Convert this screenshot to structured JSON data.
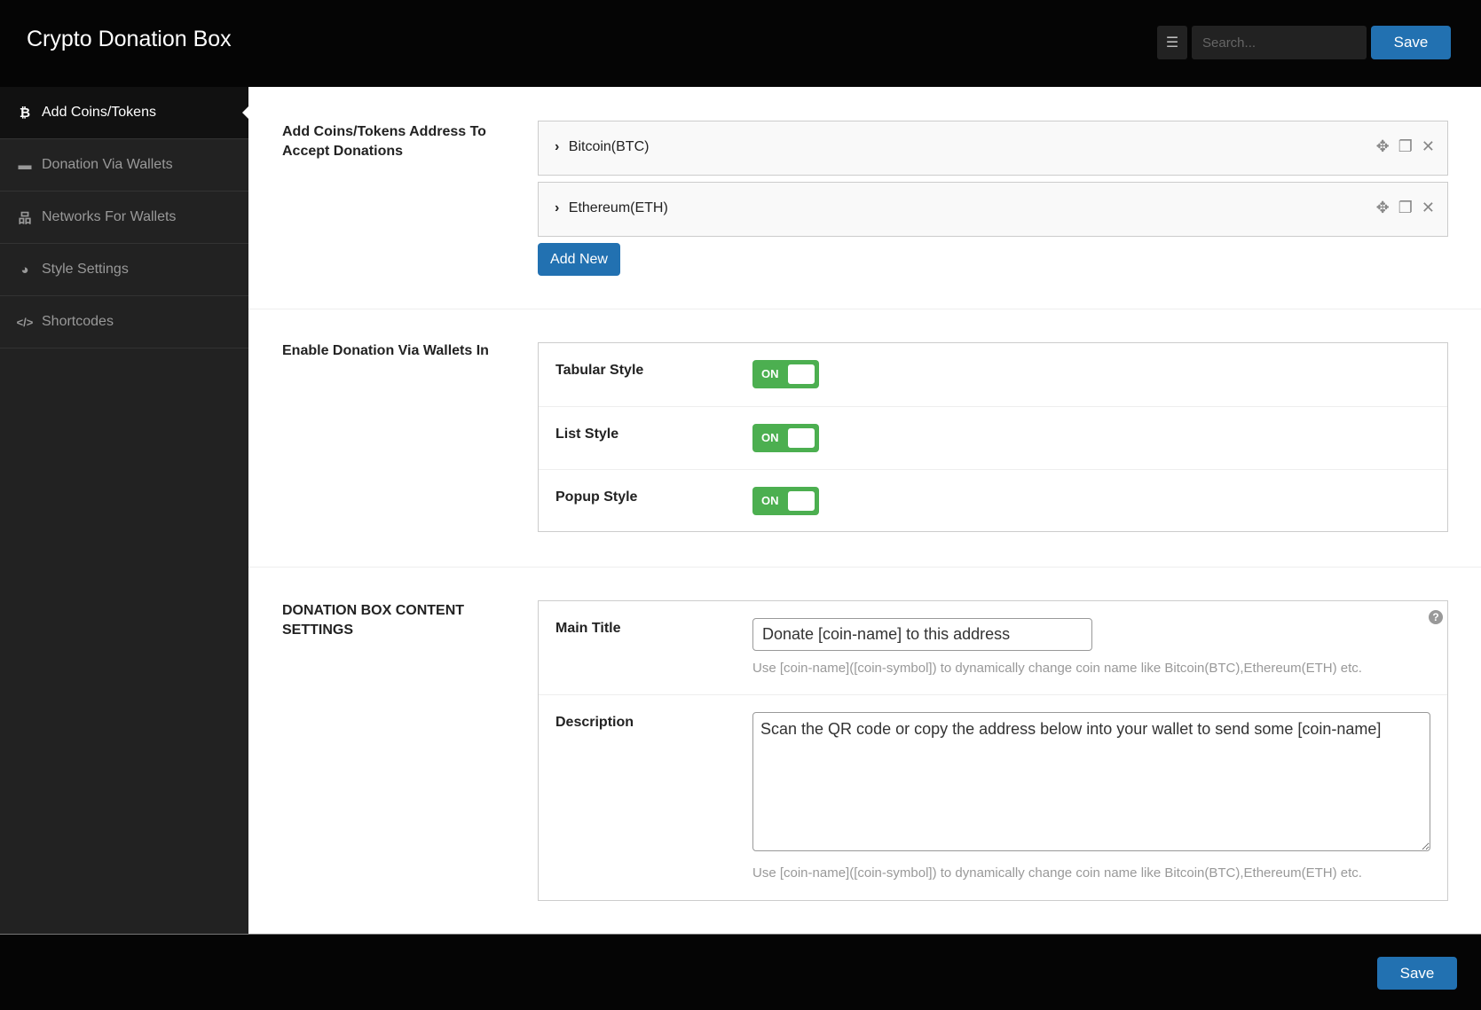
{
  "header": {
    "title": "Crypto Donation Box",
    "search_placeholder": "Search...",
    "save_label": "Save"
  },
  "sidebar": {
    "items": [
      {
        "label": "Add Coins/Tokens",
        "icon": "bitcoin-icon",
        "glyph": "₿",
        "active": true
      },
      {
        "label": "Donation Via Wallets",
        "icon": "wallet-icon",
        "glyph": "▬",
        "active": false
      },
      {
        "label": "Networks For Wallets",
        "icon": "network-icon",
        "glyph": "品",
        "active": false
      },
      {
        "label": "Style Settings",
        "icon": "palette-icon",
        "glyph": "◕",
        "active": false
      },
      {
        "label": "Shortcodes",
        "icon": "code-icon",
        "glyph": "</>",
        "active": false
      }
    ]
  },
  "sections": {
    "coins": {
      "label": "Add Coins/Tokens Address To Accept Donations",
      "items": [
        {
          "title": "Bitcoin(BTC)"
        },
        {
          "title": "Ethereum(ETH)"
        }
      ],
      "add_new_label": "Add New"
    },
    "wallets": {
      "label": "Enable Donation Via Wallets In",
      "toggles": [
        {
          "label": "Tabular Style",
          "state": "ON"
        },
        {
          "label": "List Style",
          "state": "ON"
        },
        {
          "label": "Popup Style",
          "state": "ON"
        }
      ]
    },
    "content": {
      "label": "DONATION BOX CONTENT SETTINGS",
      "main_title": {
        "label": "Main Title",
        "value": "Donate [coin-name] to this address",
        "help": "Use [coin-name]([coin-symbol]) to dynamically change coin name like Bitcoin(BTC),Ethereum(ETH) etc."
      },
      "description": {
        "label": "Description",
        "value": "Scan the QR code or copy the address below into your wallet to send some [coin-name]",
        "help": "Use [coin-name]([coin-symbol]) to dynamically change coin name like Bitcoin(BTC),Ethereum(ETH) etc."
      },
      "help_glyph": "?"
    }
  },
  "footer": {
    "save_label": "Save"
  },
  "icons": {
    "chevron": "›",
    "move": "✥",
    "clone": "❐",
    "remove": "✕",
    "toggle_menu": "☰"
  }
}
